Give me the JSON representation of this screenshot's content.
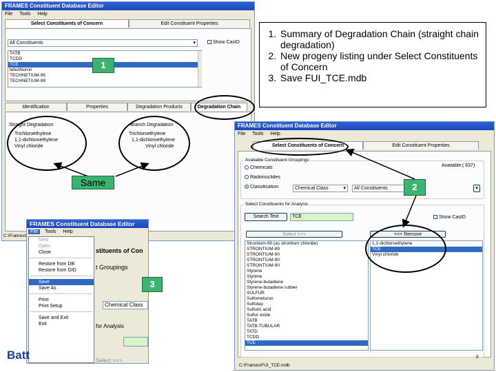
{
  "colors": {
    "title_blue": "#2d63d8",
    "selection": "#316ac5",
    "marker_green": "#3cb371",
    "window_bg": "#ece9d8"
  },
  "icons": {
    "radio_selected": "radio-on-icon",
    "checkbox": "checkbox-icon",
    "dropdown": "chevron-down-icon"
  },
  "window1": {
    "title": "FRAMES Constituent Database Editor",
    "menu": [
      "File",
      "Tools",
      "Help"
    ],
    "tabs": [
      "Select Constituents of Concern",
      "Edit Constituent Properties"
    ],
    "category_select": "All Constituents",
    "show_casid_label": "Show CasID",
    "list_items": [
      "TATB",
      "TCDD",
      "TCE",
      "tebuthiuron",
      "TECHNETIUM-95",
      "TECHNETIUM-99"
    ],
    "selected_item": "TCE",
    "subtabs": [
      "Identification",
      "Properties",
      "Degradation Products",
      "Degradation Chain"
    ],
    "straight_title": "Straight Degradation",
    "straight_items": [
      "Trichloroethylene",
      "1,1-dichloroethylene",
      "Vinyl chloride"
    ],
    "branch_title": "Branch Degradation",
    "branch_items": [
      "Trichloroethylene",
      "1,1-dichloroethylene",
      "Vinyl chloride"
    ],
    "status": "C:\\Frames\\FUI_TCE.mdb"
  },
  "notes": {
    "items": [
      "Summary of Degradation Chain (straight chain degradation)",
      "New progeny listing under Select Constituents of Concern",
      "Save FUI_TCE.mdb"
    ]
  },
  "window2": {
    "title": "FRAMES Constituent Database Editor",
    "menu": [
      "File",
      "Tools",
      "Help"
    ],
    "tabs": [
      "Select Constituents of Concern",
      "Edit Constituent Properties"
    ],
    "groupings_title": "Available Constituent Groupings",
    "radios": [
      "Chemicals",
      "Radionuclides",
      "Classification"
    ],
    "classification_select": "Chemical Class",
    "all_select": "All Constituents",
    "available_label": "Available:",
    "available_count": "( 637)",
    "selected_title": "Select Constituents for Analysis",
    "search_button": "Search Text",
    "search_value": "TCE",
    "select_button": "Select >>>",
    "remove_button": "<<< Remove",
    "show_casid_label": "Show CasID",
    "left_list": [
      "Strontium-90 (as strontium chloride)",
      "STRONTIUM-89",
      "STRONTIUM-90",
      "STRONTIUM-90",
      "STRONTIUM-90",
      "Styrene",
      "Styrene",
      "Styrene-butadiene",
      "Styrene-butadiene rubber",
      "SULFUR",
      "Sulfometuron",
      "Sulfotep",
      "Sulfuric acid",
      "Sulfur oxide",
      "TATB",
      "TATB-TUBULAR",
      "TATD",
      "TCDD",
      "TCE"
    ],
    "right_list": [
      "1,1-dichloroethylene",
      "TCE",
      "Vinyl chloride"
    ],
    "selected_right": "TCE",
    "status": "C:\\Frames\\FUI_TCE.mdb",
    "page_number": "9"
  },
  "window3": {
    "title": "FRAMES Constituent Database Editor",
    "menu": [
      "File",
      "Tools",
      "Help"
    ],
    "file_menu": [
      "New",
      "Open",
      "Close",
      "Restore from DB",
      "Restore from GID",
      "Save",
      "Save As",
      "Print",
      "Print Setup",
      "Save and Exit",
      "Exit"
    ],
    "highlighted": "Save",
    "bg_tab_text": "stituents of Con",
    "bg_groupings": "t Groupings",
    "bg_class": "Chemical Class",
    "bg_analysis": "for Analysis",
    "bg_select": "Select >>>"
  },
  "markers": [
    "1",
    "2",
    "3"
  ],
  "callout": "Same",
  "logo_text": "Batt"
}
